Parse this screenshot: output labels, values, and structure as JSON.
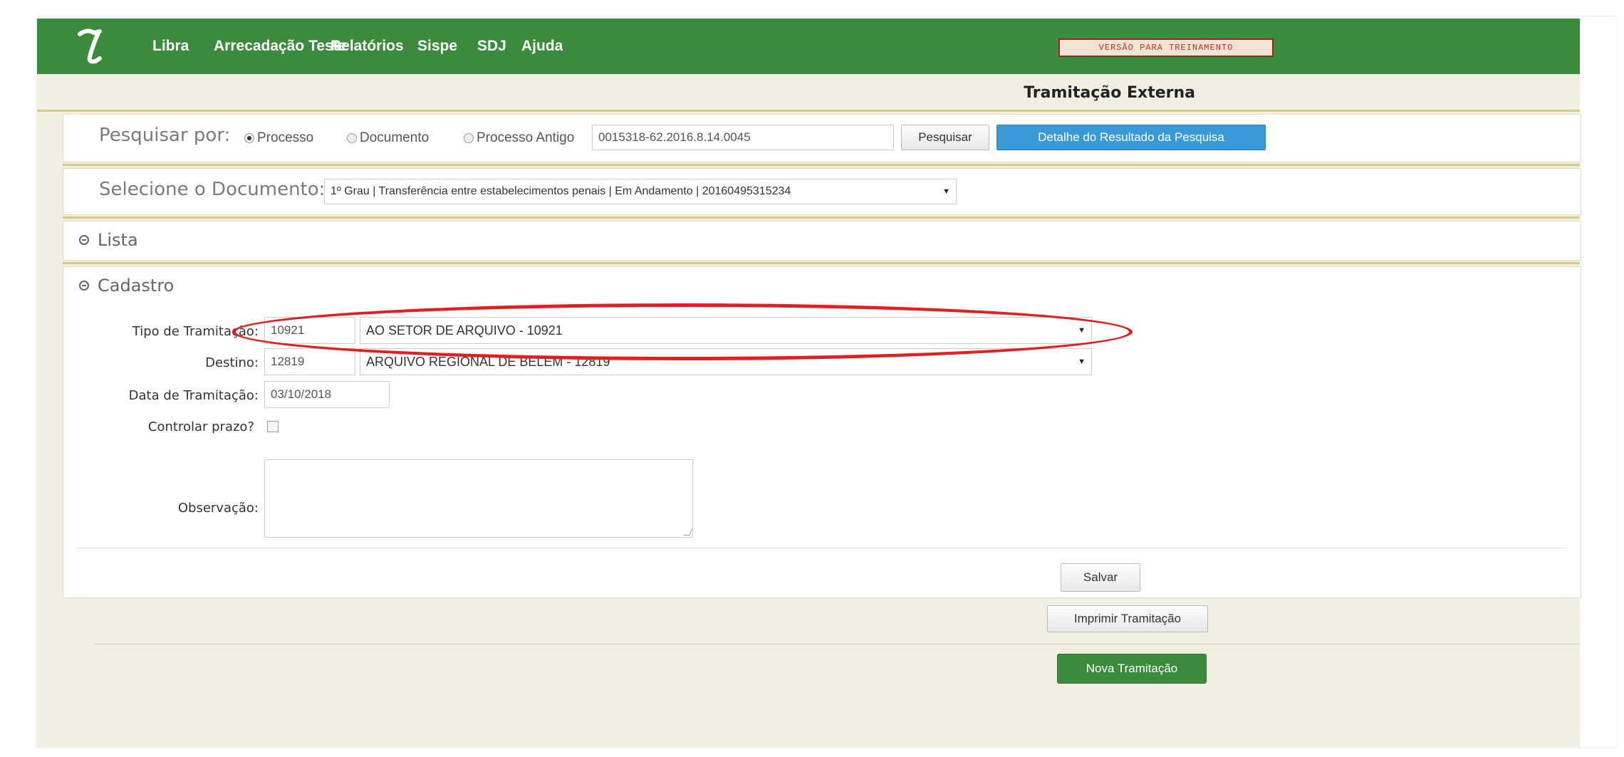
{
  "topbar": {
    "training_label": "VERSÃO PARA TREINAMENTO",
    "nav": [
      {
        "label": "Libra"
      },
      {
        "label": "Arrecadação Teste"
      },
      {
        "label": "Relatórios"
      },
      {
        "label": "Sispe"
      },
      {
        "label": "SDJ"
      },
      {
        "label": "Ajuda"
      }
    ]
  },
  "page": {
    "title": "Tramitação Externa"
  },
  "search": {
    "label": "Pesquisar por:",
    "options": [
      {
        "label": "Processo",
        "selected": true
      },
      {
        "label": "Documento",
        "selected": false
      },
      {
        "label": "Processo Antigo",
        "selected": false
      }
    ],
    "value": "0015318-62.2016.8.14.0045",
    "search_button": "Pesquisar",
    "detail_button": "Detalhe do Resultado da Pesquisa"
  },
  "document_select": {
    "label": "Selecione o Documento:",
    "value": "1º Grau | Transferência entre estabelecimentos penais | Em Andamento | 20160495315234"
  },
  "sections": {
    "lista": "Lista",
    "cadastro": "Cadastro"
  },
  "form": {
    "tipo_label": "Tipo de Tramitação:",
    "tipo_code": "10921",
    "tipo_value": "AO SETOR DE ARQUIVO - 10921",
    "destino_label": "Destino:",
    "destino_code": "12819",
    "destino_value": "ARQUIVO REGIONAL DE BELEM - 12819",
    "data_label": "Data de Tramitação:",
    "data_value": "03/10/2018",
    "prazo_label": "Controlar prazo?",
    "observacao_label": "Observação:"
  },
  "actions": {
    "salvar": "Salvar",
    "imprimir": "Imprimir Tramitação",
    "nova": "Nova Tramitação"
  },
  "colors": {
    "brand_green": "#3c8a3c",
    "accent_blue": "#3a9ad6",
    "highlight_red": "#e02020"
  }
}
